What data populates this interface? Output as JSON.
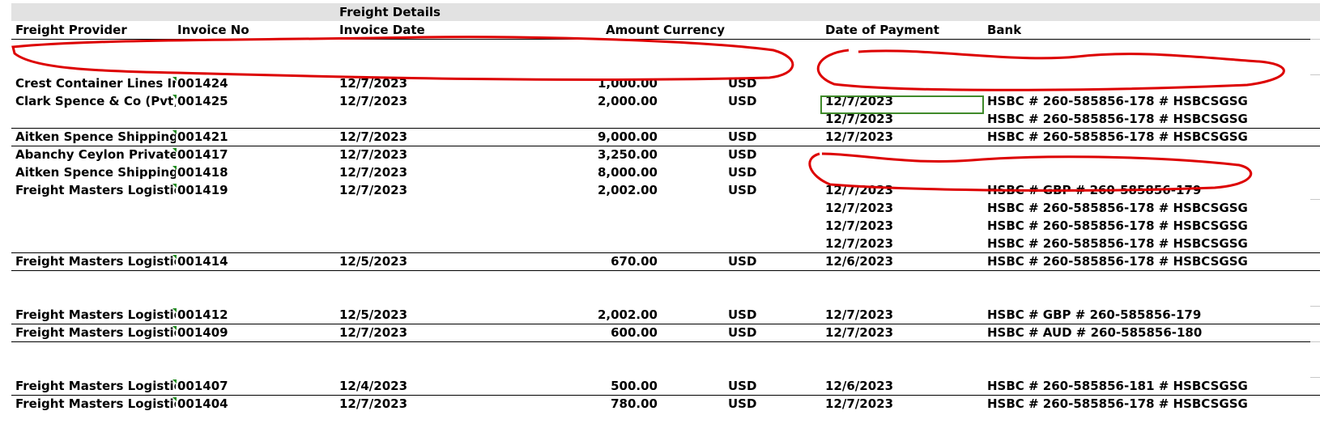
{
  "sheet": {
    "section_title": "Freight Details",
    "columns": {
      "provider": "Freight Provider",
      "invoice_no": "Invoice No",
      "invoice_date": "Invoice Date",
      "amount": "Amount",
      "currency": "Currency",
      "payment_date": "Date of Payment",
      "bank": "Bank"
    },
    "rows": [
      {
        "provider": "Crest Container Lines In",
        "invoice": "001424",
        "date": "12/7/2023",
        "amount": "1,000.00",
        "currency": "USD",
        "pay": "",
        "bank": ""
      },
      {
        "provider": "Clark Spence & Co (Pvt)",
        "invoice": "001425",
        "date": "12/7/2023",
        "amount": "2,000.00",
        "currency": "USD",
        "pay": "12/7/2023",
        "bank": "HSBC # 260-585856-178 # HSBCSGSG"
      },
      {
        "provider": "",
        "invoice": "",
        "date": "",
        "amount": "",
        "currency": "",
        "pay": "12/7/2023",
        "bank": "HSBC # 260-585856-178 # HSBCSGSG"
      },
      {
        "provider": "Aitken Spence Shipping",
        "invoice": "001421",
        "date": "12/7/2023",
        "amount": "9,000.00",
        "currency": "USD",
        "pay": "12/7/2023",
        "bank": "HSBC # 260-585856-178 # HSBCSGSG"
      },
      {
        "provider": "Abanchy Ceylon Private",
        "invoice": "001417",
        "date": "12/7/2023",
        "amount": "3,250.00",
        "currency": "USD",
        "pay": "",
        "bank": ""
      },
      {
        "provider": "Aitken Spence Shipping",
        "invoice": "001418",
        "date": "12/7/2023",
        "amount": "8,000.00",
        "currency": "USD",
        "pay": "",
        "bank": ""
      },
      {
        "provider": "Freight Masters Logistic",
        "invoice": "001419",
        "date": "12/7/2023",
        "amount": "2,002.00",
        "currency": "USD",
        "pay": "12/7/2023",
        "bank": "HSBC # GBP # 260-585856-179"
      },
      {
        "provider": "",
        "invoice": "",
        "date": "",
        "amount": "",
        "currency": "",
        "pay": "12/7/2023",
        "bank": "HSBC # 260-585856-178 # HSBCSGSG"
      },
      {
        "provider": "",
        "invoice": "",
        "date": "",
        "amount": "",
        "currency": "",
        "pay": "12/7/2023",
        "bank": "HSBC # 260-585856-178 # HSBCSGSG"
      },
      {
        "provider": "",
        "invoice": "",
        "date": "",
        "amount": "",
        "currency": "",
        "pay": "12/7/2023",
        "bank": "HSBC # 260-585856-178 # HSBCSGSG"
      },
      {
        "provider": "Freight Masters Logistic",
        "invoice": "001414",
        "date": "12/5/2023",
        "amount": "670.00",
        "currency": "USD",
        "pay": "12/6/2023",
        "bank": "HSBC # 260-585856-178 # HSBCSGSG"
      },
      {
        "provider": "Freight Masters Logistic",
        "invoice": "001412",
        "date": "12/5/2023",
        "amount": "2,002.00",
        "currency": "USD",
        "pay": "12/7/2023",
        "bank": "HSBC # GBP # 260-585856-179"
      },
      {
        "provider": "Freight Masters Logistic",
        "invoice": "001409",
        "date": "12/7/2023",
        "amount": "600.00",
        "currency": "USD",
        "pay": "12/7/2023",
        "bank": "HSBC # AUD # 260-585856-180"
      },
      {
        "provider": "Freight Masters Logistic",
        "invoice": "001407",
        "date": "12/4/2023",
        "amount": "500.00",
        "currency": "USD",
        "pay": "12/6/2023",
        "bank": "HSBC # 260-585856-181 # HSBCSGSG"
      },
      {
        "provider": "Freight Masters Logistic",
        "invoice": "001404",
        "date": "12/7/2023",
        "amount": "780.00",
        "currency": "USD",
        "pay": "12/7/2023",
        "bank": "HSBC # 260-585856-178 # HSBCSGSG"
      }
    ]
  },
  "colors": {
    "header_fill": "#e2e2e2",
    "scribble": "#dd0000",
    "selection": "#3f8a2a",
    "comment_indicator": "#1f8a1f"
  }
}
